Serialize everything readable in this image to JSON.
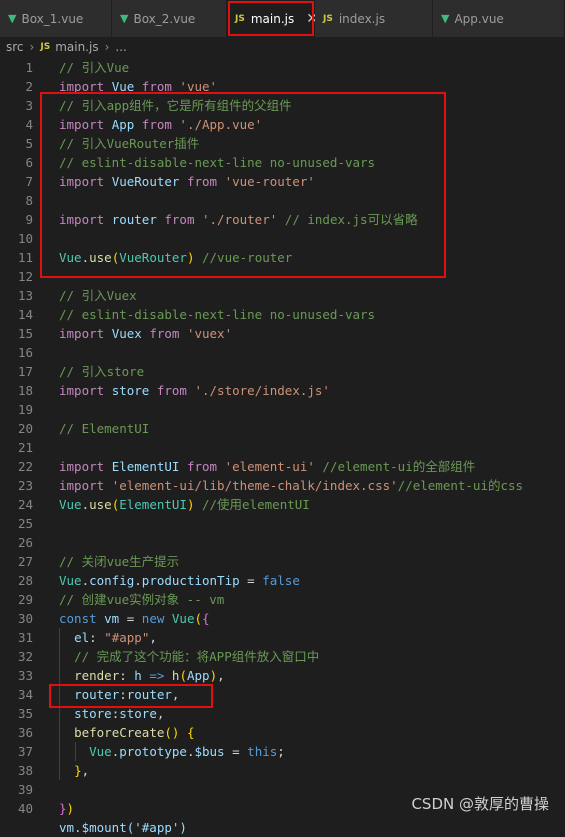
{
  "tabs": [
    {
      "icon": "vue-icon",
      "label": "Box_1.vue",
      "active": false
    },
    {
      "icon": "vue-icon",
      "label": "Box_2.vue",
      "active": false
    },
    {
      "icon": "js-icon",
      "label": "main.js",
      "active": true
    },
    {
      "icon": "js-icon",
      "label": "index.js",
      "active": false
    },
    {
      "icon": "vue-icon",
      "label": "App.vue",
      "active": false
    }
  ],
  "tab_close_glyph": "✕",
  "js_badge": "JS",
  "breadcrumb": {
    "folder": "src",
    "file": "main.js",
    "more": "..."
  },
  "lines": [
    {
      "n": "1",
      "t": [
        [
          "comment",
          "// 引入Vue"
        ]
      ]
    },
    {
      "n": "2",
      "t": [
        [
          "keyword",
          "import "
        ],
        [
          "ident",
          "Vue"
        ],
        [
          "keyword",
          " from "
        ],
        [
          "string",
          "'vue'"
        ]
      ]
    },
    {
      "n": "3",
      "t": [
        [
          "comment",
          "// 引入app组件，它是所有组件的父组件"
        ]
      ]
    },
    {
      "n": "4",
      "t": [
        [
          "keyword",
          "import "
        ],
        [
          "ident",
          "App"
        ],
        [
          "keyword",
          " from "
        ],
        [
          "string",
          "'./App.vue'"
        ]
      ]
    },
    {
      "n": "5",
      "t": [
        [
          "comment",
          "// 引入VueRouter插件"
        ]
      ]
    },
    {
      "n": "6",
      "t": [
        [
          "comment",
          "// eslint-disable-next-line no-unused-vars"
        ]
      ]
    },
    {
      "n": "7",
      "t": [
        [
          "keyword",
          "import "
        ],
        [
          "ident",
          "VueRouter"
        ],
        [
          "keyword",
          " from "
        ],
        [
          "string",
          "'vue-router'"
        ]
      ]
    },
    {
      "n": "8",
      "t": []
    },
    {
      "n": "9",
      "t": [
        [
          "keyword",
          "import "
        ],
        [
          "ident",
          "router"
        ],
        [
          "keyword",
          " from "
        ],
        [
          "string",
          "'./router'"
        ],
        [
          "comment",
          " // index.js可以省略"
        ]
      ]
    },
    {
      "n": "10",
      "t": []
    },
    {
      "n": "11",
      "t": [
        [
          "class",
          "Vue"
        ],
        [
          "punct",
          "."
        ],
        [
          "func",
          "use"
        ],
        [
          "bracket",
          "("
        ],
        [
          "class",
          "VueRouter"
        ],
        [
          "bracket",
          ")"
        ],
        [
          "comment",
          " //vue-router"
        ]
      ]
    },
    {
      "n": "12",
      "t": []
    },
    {
      "n": "13",
      "t": [
        [
          "comment",
          "// 引入Vuex"
        ]
      ]
    },
    {
      "n": "14",
      "t": [
        [
          "comment",
          "// eslint-disable-next-line no-unused-vars"
        ]
      ]
    },
    {
      "n": "15",
      "t": [
        [
          "keyword",
          "import "
        ],
        [
          "ident",
          "Vuex"
        ],
        [
          "keyword",
          " from "
        ],
        [
          "string",
          "'vuex'"
        ]
      ]
    },
    {
      "n": "16",
      "t": []
    },
    {
      "n": "17",
      "t": [
        [
          "comment",
          "// 引入store"
        ]
      ]
    },
    {
      "n": "18",
      "t": [
        [
          "keyword",
          "import "
        ],
        [
          "ident",
          "store"
        ],
        [
          "keyword",
          " from "
        ],
        [
          "string",
          "'./store/index.js'"
        ]
      ]
    },
    {
      "n": "19",
      "t": []
    },
    {
      "n": "20",
      "t": [
        [
          "comment",
          "// ElementUI"
        ]
      ]
    },
    {
      "n": "21",
      "t": []
    },
    {
      "n": "22",
      "t": [
        [
          "keyword",
          "import "
        ],
        [
          "ident",
          "ElementUI"
        ],
        [
          "keyword",
          " from "
        ],
        [
          "string",
          "'element-ui'"
        ],
        [
          "comment",
          " //element-ui的全部组件"
        ]
      ]
    },
    {
      "n": "23",
      "t": [
        [
          "keyword",
          "import "
        ],
        [
          "string",
          "'element-ui/lib/theme-chalk/index.css'"
        ],
        [
          "comment",
          "//element-ui的css"
        ]
      ]
    },
    {
      "n": "24",
      "t": [
        [
          "class",
          "Vue"
        ],
        [
          "punct",
          "."
        ],
        [
          "func",
          "use"
        ],
        [
          "bracket",
          "("
        ],
        [
          "class",
          "ElementUI"
        ],
        [
          "bracket",
          ")"
        ],
        [
          "comment",
          " //使用elementUI"
        ]
      ]
    },
    {
      "n": "25",
      "t": []
    },
    {
      "n": "26",
      "t": []
    },
    {
      "n": "27",
      "t": [
        [
          "comment",
          "// 关闭vue生产提示"
        ]
      ]
    },
    {
      "n": "28",
      "t": [
        [
          "class",
          "Vue"
        ],
        [
          "punct",
          "."
        ],
        [
          "ident",
          "config"
        ],
        [
          "punct",
          "."
        ],
        [
          "ident",
          "productionTip"
        ],
        [
          "punct",
          " = "
        ],
        [
          "storage",
          "false"
        ]
      ]
    },
    {
      "n": "29",
      "t": [
        [
          "comment",
          "// 创建vue实例对象 -- vm"
        ]
      ]
    },
    {
      "n": "30",
      "t": [
        [
          "storage",
          "const "
        ],
        [
          "ident",
          "vm"
        ],
        [
          "punct",
          " = "
        ],
        [
          "storage",
          "new "
        ],
        [
          "class",
          "Vue"
        ],
        [
          "bracket",
          "("
        ],
        [
          "bracket2",
          "{"
        ]
      ]
    },
    {
      "n": "31",
      "t": [
        [
          "punct",
          "  "
        ],
        [
          "ident",
          "el"
        ],
        [
          "punct",
          ": "
        ],
        [
          "string",
          "\"#app\""
        ],
        [
          "punct",
          ","
        ]
      ]
    },
    {
      "n": "32",
      "t": [
        [
          "punct",
          "  "
        ],
        [
          "comment",
          "// 完成了这个功能：将APP组件放入窗口中"
        ]
      ]
    },
    {
      "n": "33",
      "t": [
        [
          "punct",
          "  "
        ],
        [
          "func",
          "render"
        ],
        [
          "punct",
          ": "
        ],
        [
          "ident",
          "h"
        ],
        [
          "storage",
          " => "
        ],
        [
          "func",
          "h"
        ],
        [
          "bracket",
          "("
        ],
        [
          "ident",
          "App"
        ],
        [
          "bracket",
          ")"
        ],
        [
          "punct",
          ","
        ]
      ]
    },
    {
      "n": "34",
      "t": [
        [
          "punct",
          "  "
        ],
        [
          "ident",
          "router"
        ],
        [
          "punct",
          ":"
        ],
        [
          "ident",
          "router"
        ],
        [
          "punct",
          ","
        ]
      ]
    },
    {
      "n": "35",
      "t": [
        [
          "punct",
          "  "
        ],
        [
          "ident",
          "store"
        ],
        [
          "punct",
          ":"
        ],
        [
          "ident",
          "store"
        ],
        [
          "punct",
          ","
        ]
      ]
    },
    {
      "n": "36",
      "t": [
        [
          "punct",
          "  "
        ],
        [
          "func",
          "beforeCreate"
        ],
        [
          "bracket",
          "()"
        ],
        [
          "punct",
          " "
        ],
        [
          "bracket",
          "{"
        ]
      ]
    },
    {
      "n": "37",
      "t": [
        [
          "punct",
          "    "
        ],
        [
          "class",
          "Vue"
        ],
        [
          "punct",
          "."
        ],
        [
          "ident",
          "prototype"
        ],
        [
          "punct",
          "."
        ],
        [
          "ident",
          "$bus"
        ],
        [
          "punct",
          " = "
        ],
        [
          "storage",
          "this"
        ],
        [
          "punct",
          ";"
        ]
      ]
    },
    {
      "n": "38",
      "t": [
        [
          "punct",
          "  "
        ],
        [
          "bracket",
          "}"
        ],
        [
          "punct",
          ","
        ]
      ]
    },
    {
      "n": "39",
      "t": []
    },
    {
      "n": "40",
      "t": [
        [
          "bracket2",
          "}"
        ],
        [
          "bracket",
          ")"
        ]
      ]
    }
  ],
  "partial_line": "vm.$mount('#app')",
  "watermark": "CSDN @敦厚的曹操"
}
